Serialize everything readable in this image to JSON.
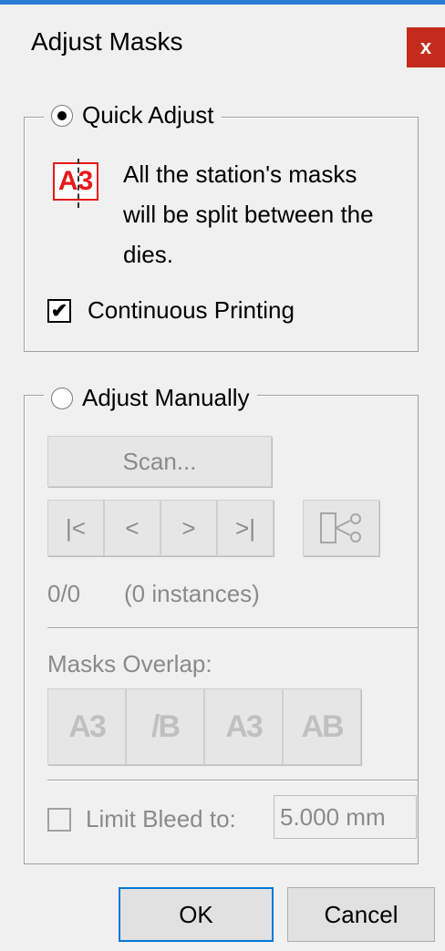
{
  "window": {
    "title": "Adjust Masks",
    "close_label": "x"
  },
  "quick_adjust": {
    "label": "Quick Adjust",
    "selected": true,
    "icon_text": "A3",
    "description_lines": [
      "All the station's masks",
      "will be split between the",
      "dies."
    ],
    "continuous_printing": {
      "label": "Continuous Printing",
      "checked": true,
      "mark": "✔"
    }
  },
  "manual": {
    "label": "Adjust Manually",
    "selected": false,
    "scan_label": "Scan...",
    "nav": {
      "first": "|<",
      "prev": "<",
      "next": ">",
      "last": ">|"
    },
    "counter": "0/0",
    "instances": "(0 instances)",
    "masks_overlap_label": "Masks Overlap:",
    "overlap_icons": [
      "A3",
      "/B",
      "A3",
      "AB"
    ],
    "limit_bleed": {
      "label": "Limit Bleed to:",
      "checked": false,
      "value": "5.000 mm"
    }
  },
  "footer": {
    "ok_label": "OK",
    "cancel_label": "Cancel"
  }
}
